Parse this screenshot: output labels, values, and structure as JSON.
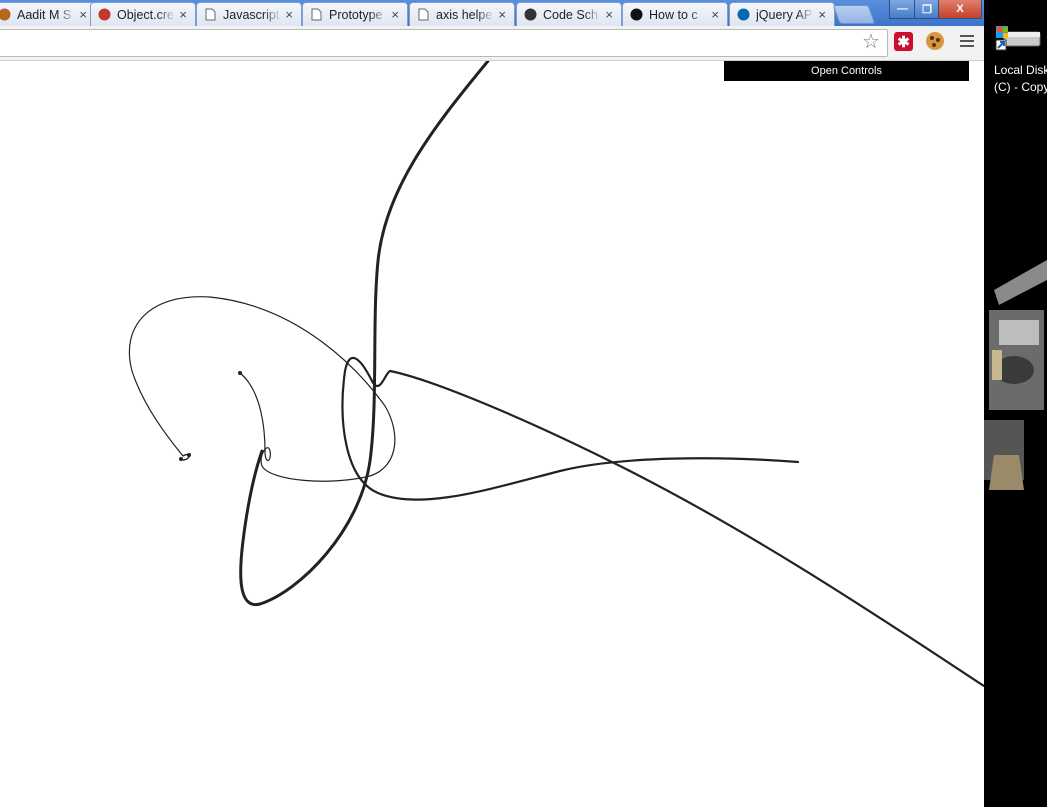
{
  "browser": {
    "tabs": [
      {
        "label": "Aadit M S",
        "icon": "favicon-avatar-icon"
      },
      {
        "label": "Object.cre",
        "icon": "mdn-dino-icon"
      },
      {
        "label": "Javascript",
        "icon": "page-icon"
      },
      {
        "label": "Prototype",
        "icon": "page-icon"
      },
      {
        "label": "axis helpe",
        "icon": "page-icon"
      },
      {
        "label": "Code Sch",
        "icon": "code-school-icon"
      },
      {
        "label": "How to c",
        "icon": "github-icon"
      },
      {
        "label": "jQuery AP",
        "icon": "jquery-icon"
      }
    ],
    "window_buttons": {
      "minimize": "—",
      "maximize": "❐",
      "close": "X"
    },
    "close_glyph": "×",
    "omnibox_value": ""
  },
  "page": {
    "open_controls_label": "Open Controls"
  },
  "desktop": {
    "icon_label_line1": "Local Disk",
    "icon_label_line2": "(C) - Copy"
  },
  "colors": {
    "tabstrip": "#4a80d0",
    "control_bar": "#000000",
    "curve": "#222222"
  }
}
